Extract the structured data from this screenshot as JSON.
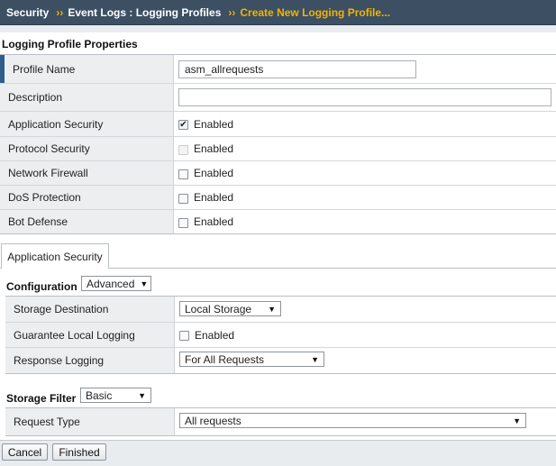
{
  "breadcrumb": {
    "items": [
      "Security",
      "Event Logs : Logging Profiles"
    ],
    "current": "Create New Logging Profile...",
    "separator": "››"
  },
  "properties": {
    "title": "Logging Profile Properties",
    "profile_name": {
      "label": "Profile Name",
      "value": "asm_allrequests"
    },
    "description": {
      "label": "Description",
      "value": ""
    },
    "modules": [
      {
        "label": "Application Security",
        "checkbox": "Enabled",
        "checked": true,
        "disabled": false
      },
      {
        "label": "Protocol Security",
        "checkbox": "Enabled",
        "checked": false,
        "disabled": true
      },
      {
        "label": "Network Firewall",
        "checkbox": "Enabled",
        "checked": false,
        "disabled": false
      },
      {
        "label": "DoS Protection",
        "checkbox": "Enabled",
        "checked": false,
        "disabled": false
      },
      {
        "label": "Bot Defense",
        "checkbox": "Enabled",
        "checked": false,
        "disabled": false
      }
    ]
  },
  "app_security": {
    "tab_label": "Application Security",
    "configuration": {
      "label": "Configuration",
      "value": "Advanced"
    },
    "storage_destination": {
      "label": "Storage Destination",
      "value": "Local Storage"
    },
    "guarantee_local_logging": {
      "label": "Guarantee Local Logging",
      "checkbox": "Enabled",
      "checked": false
    },
    "response_logging": {
      "label": "Response Logging",
      "value": "For All Requests"
    },
    "storage_filter": {
      "label": "Storage Filter",
      "value": "Basic"
    },
    "request_type": {
      "label": "Request Type",
      "value": "All requests"
    }
  },
  "actions": {
    "cancel": "Cancel",
    "finished": "Finished"
  },
  "colors": {
    "header_bg": "#3c4f63",
    "header_current": "#f0b400",
    "label_bg": "#eceeef",
    "active_marker": "#2d5e8c"
  }
}
